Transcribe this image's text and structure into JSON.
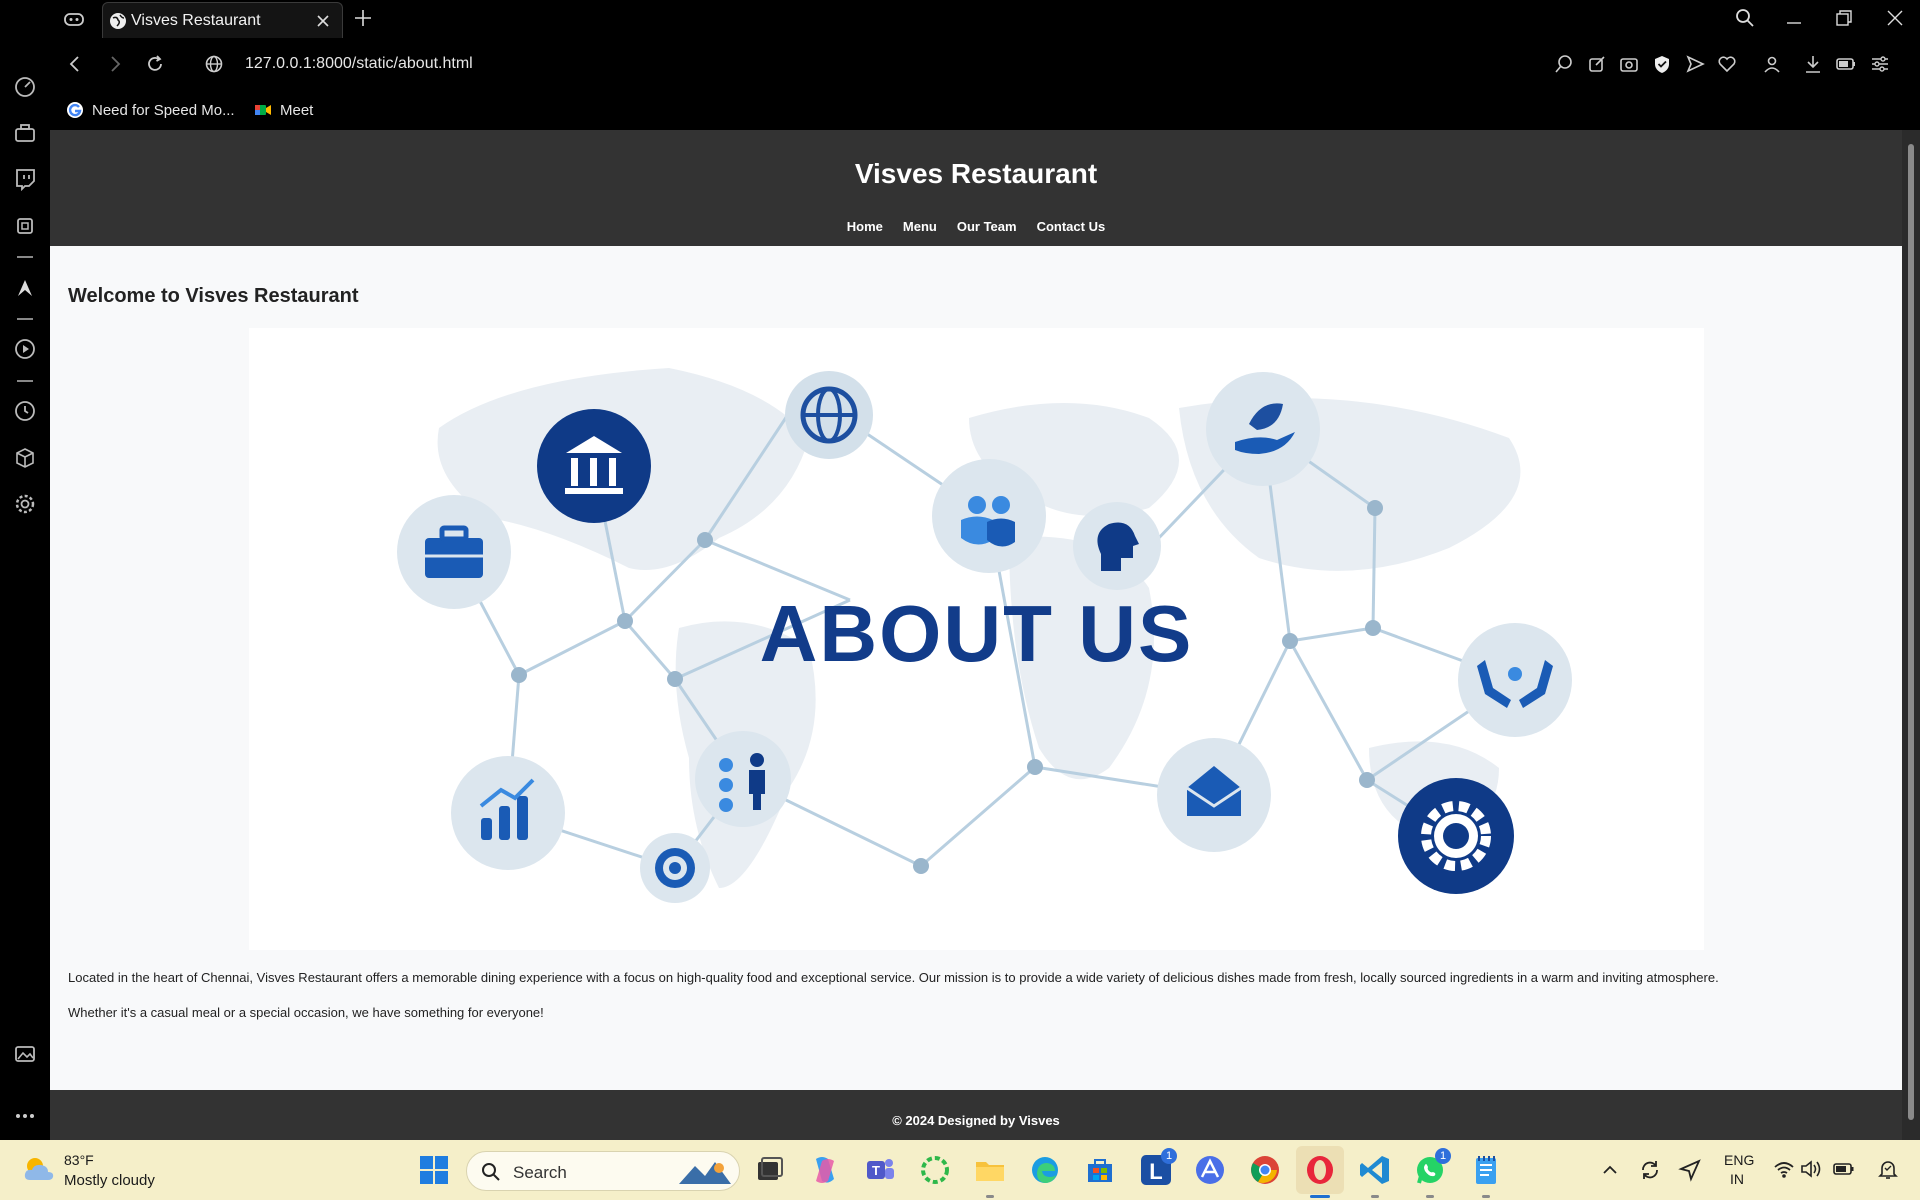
{
  "browser": {
    "tab_title": "Visves Restaurant",
    "url": "127.0.0.1:8000/static/about.html",
    "bookmarks": [
      {
        "label": "Need for Speed Mo...",
        "icon": "google-icon"
      },
      {
        "label": "Meet",
        "icon": "meet-icon"
      }
    ]
  },
  "page": {
    "site_title": "Visves Restaurant",
    "nav": [
      "Home",
      "Menu",
      "Our Team",
      "Contact Us"
    ],
    "welcome_heading": "Welcome to Visves Restaurant",
    "hero_heading": "ABOUT US",
    "paragraph_1": "Located in the heart of Chennai, Visves Restaurant offers a memorable dining experience with a focus on high-quality food and exceptional service. Our mission is to provide a wide variety of delicious dishes made from fresh, locally sourced ingredients in a warm and inviting atmosphere.",
    "paragraph_2": "Whether it's a casual meal or a special occasion, we have something for everyone!",
    "footer": "© 2024 Designed by Visves"
  },
  "taskbar": {
    "weather_temp": "83°F",
    "weather_desc": "Mostly cloudy",
    "search_placeholder": "Search",
    "badge_l": "1",
    "badge_whatsapp": "1",
    "lang_1": "ENG",
    "lang_2": "IN"
  },
  "colors": {
    "header_bg": "#333333",
    "page_bg": "#f8f9fa",
    "hero_blue": "#123c8a",
    "taskbar_bg": "#f5efc9"
  }
}
